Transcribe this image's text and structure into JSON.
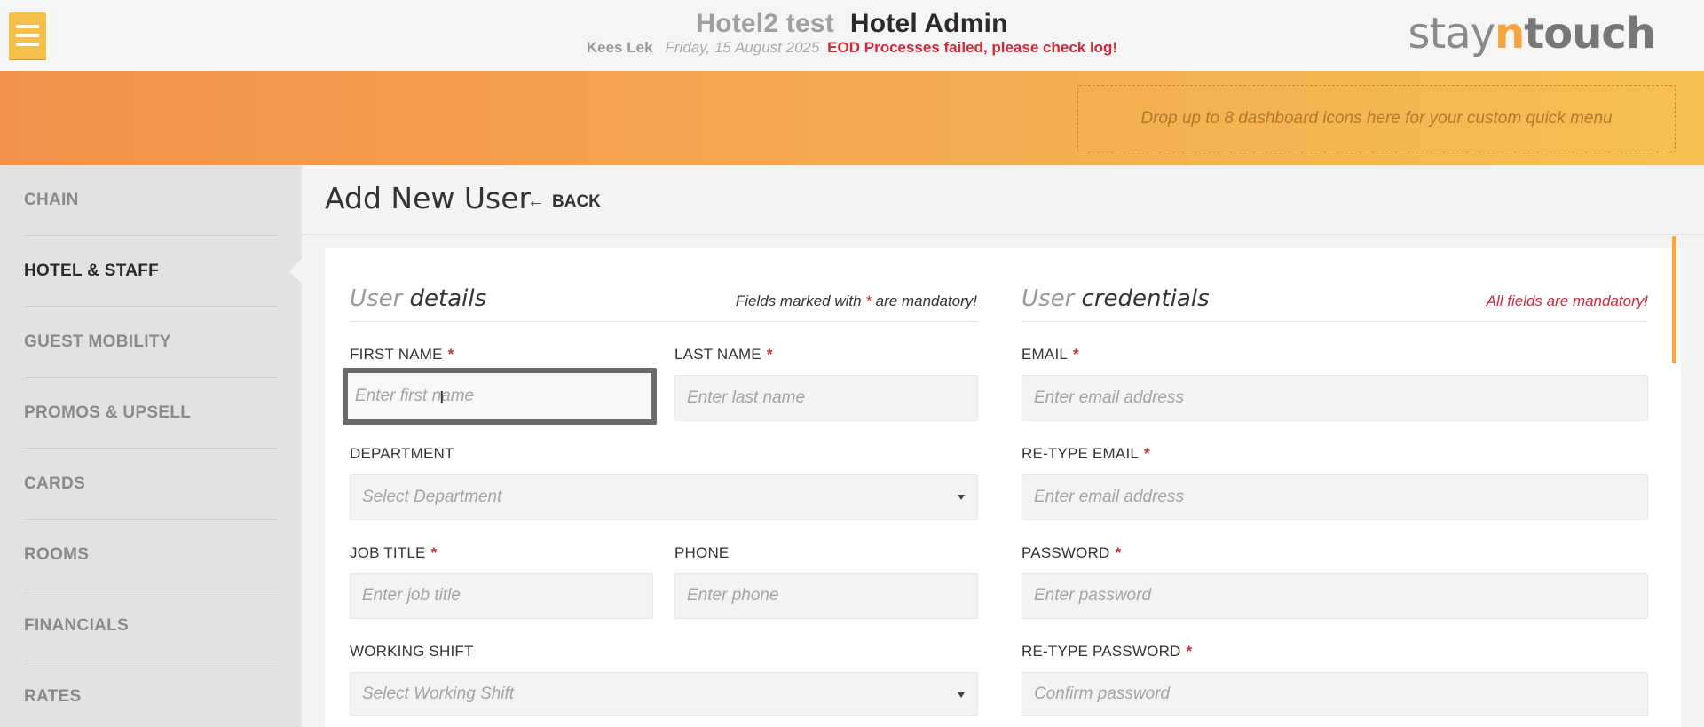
{
  "header": {
    "hotel_name": "Hotel2 test",
    "app_title": "Hotel Admin",
    "user_name": "Kees Lek",
    "date": "Friday, 15 August 2025",
    "error_message": "EOD Processes failed, please check log!",
    "logo": {
      "part1": "stay",
      "part2": "n",
      "part3": "touch"
    },
    "menu_icon": "hamburger-icon"
  },
  "banner": {
    "dropzone_text": "Drop up to 8 dashboard icons here for your custom quick menu"
  },
  "sidebar": {
    "items": [
      {
        "label": "CHAIN"
      },
      {
        "label": "HOTEL & STAFF"
      },
      {
        "label": "GUEST MOBILITY"
      },
      {
        "label": "PROMOS & UPSELL"
      },
      {
        "label": "CARDS"
      },
      {
        "label": "ROOMS"
      },
      {
        "label": "FINANCIALS"
      },
      {
        "label": "RATES"
      }
    ],
    "active": "HOTEL & STAFF"
  },
  "page": {
    "title": "Add New User",
    "back_label": "BACK",
    "back_icon": "arrow-left-icon"
  },
  "user_details": {
    "heading_light": "User",
    "heading_dark": "details",
    "note_before": "Fields marked with",
    "note_star": "*",
    "note_after": "are mandatory!",
    "first_name": {
      "label": "FIRST NAME",
      "required": "*",
      "value": "",
      "placeholder": "Enter first name"
    },
    "last_name": {
      "label": "LAST NAME",
      "required": "*",
      "value": "",
      "placeholder": "Enter last name"
    },
    "department": {
      "label": "DEPARTMENT",
      "placeholder": "Select Department"
    },
    "job_title": {
      "label": "JOB TITLE",
      "required": "*",
      "value": "",
      "placeholder": "Enter job title"
    },
    "phone": {
      "label": "PHONE",
      "value": "",
      "placeholder": "Enter phone"
    },
    "working_shift": {
      "label": "WORKING SHIFT",
      "placeholder": "Select Working Shift"
    }
  },
  "user_credentials": {
    "heading_light": "User",
    "heading_dark": "credentials",
    "note": "All fields are mandatory!",
    "email": {
      "label": "EMAIL",
      "required": "*",
      "value": "",
      "placeholder": "Enter email address"
    },
    "retype_email": {
      "label": "RE-TYPE EMAIL",
      "required": "*",
      "value": "",
      "placeholder": "Enter email address"
    },
    "password": {
      "label": "PASSWORD",
      "required": "*",
      "value": "",
      "placeholder": "Enter password"
    },
    "retype_password": {
      "label": "RE-TYPE PASSWORD",
      "required": "*",
      "value": "",
      "placeholder": "Confirm password"
    }
  },
  "colors": {
    "accent_orange": "#f5a442",
    "error_red": "#d02a3a",
    "menu_yellow": "#f5c04a"
  }
}
